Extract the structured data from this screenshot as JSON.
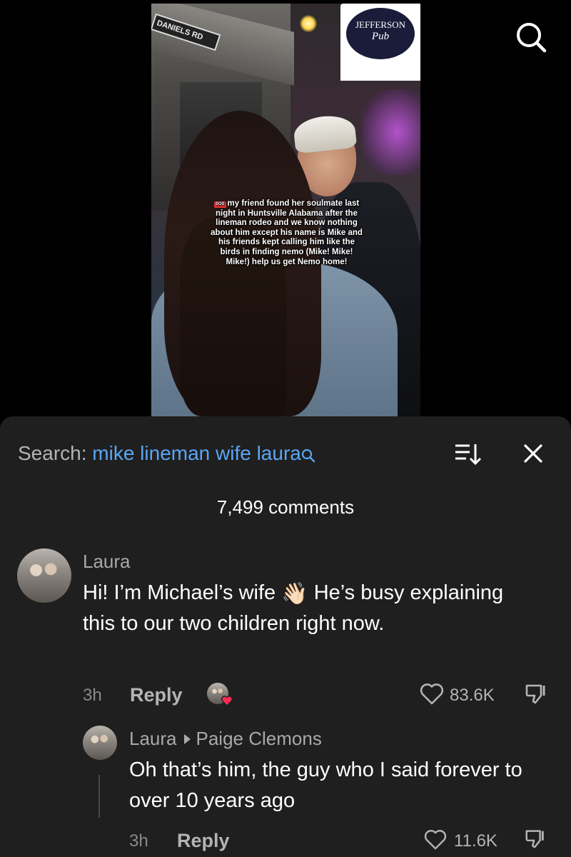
{
  "video": {
    "street_sign": "DANIELS RD",
    "pub_name_line1": "JEFFERSON",
    "pub_name_line2": "Pub",
    "caption_badge": "SOS",
    "caption": "my friend found her soulmate last night in Huntsville Alabama after the lineman rodeo and we know nothing about him except his name is Mike and his friends kept calling him like the birds in finding nemo (Mike! Mike! Mike!) help us get Nemo home!"
  },
  "top_bar": {
    "search_icon": "search-icon"
  },
  "comments_panel": {
    "search_label": "Search:",
    "search_query": "mike lineman wife laura",
    "sort_icon": "sort-icon",
    "close_icon": "close-icon",
    "comment_count": "7,499 comments",
    "comments": [
      {
        "author": "Laura",
        "text_part1": "Hi! I’m Michael’s wife",
        "emoji": "👋🏻",
        "text_part2": "He’s busy explaining this to our two children right now.",
        "time": "3h",
        "reply_label": "Reply",
        "likes": "83.6K"
      },
      {
        "author": "Laura",
        "reply_to": "Paige Clemons",
        "text": "Oh that’s him, the guy who I said forever to over 10 years ago",
        "time": "3h",
        "reply_label": "Reply",
        "likes": "11.6K"
      }
    ]
  },
  "colors": {
    "background": "#000000",
    "panel": "#1f1f1f",
    "query_blue": "#5aa6f5",
    "liked_heart": "#fe2c55"
  }
}
